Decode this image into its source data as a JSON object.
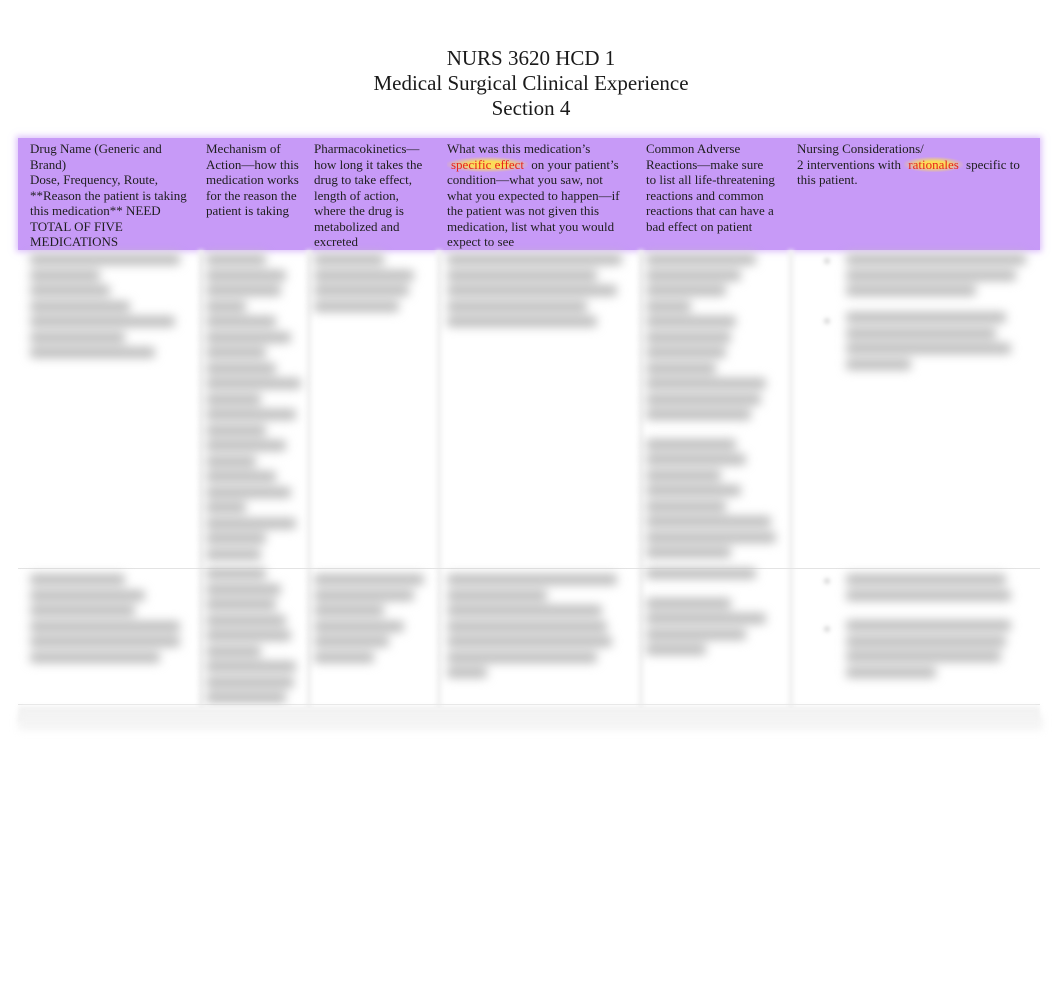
{
  "document": {
    "title_lines": [
      "NURS 3620 HCD 1",
      "Medical Surgical Clinical Experience",
      "Section 4"
    ]
  },
  "table": {
    "header_color": "#c79af7",
    "highlight_text_color": "#e8241a",
    "highlight_bg_color": "#ffe050",
    "headers": [
      {
        "lines": [
          "Drug Name (Generic and Brand)",
          "Dose, Frequency, Route, **Reason the patient is taking this medication** NEED TOTAL OF FIVE MEDICATIONS"
        ]
      },
      {
        "lines": [
          "Mechanism of Action—how this medication works for the reason the patient is taking"
        ]
      },
      {
        "lines": [
          "Pharmacokinetics—how long it takes the drug to take effect, length of action, where the drug is metabolized and excreted"
        ]
      },
      {
        "before": "What was this medication’s ",
        "highlight": "specific effect",
        "after": " on your patient’s condition—what you saw, not what you expected to happen—if the patient was not given this medication, list what you would expect to see"
      },
      {
        "lines": [
          "Common Adverse Reactions—make sure to list all life-threatening reactions and common reactions that can have a bad effect on patient"
        ]
      },
      {
        "line1": "Nursing Considerations/",
        "before": "2 interventions with ",
        "highlight": "rationales",
        "after": " specific to this patient."
      }
    ],
    "rows_note": "Body rows are blurred (content obscured)",
    "row_count_visible": 2
  }
}
